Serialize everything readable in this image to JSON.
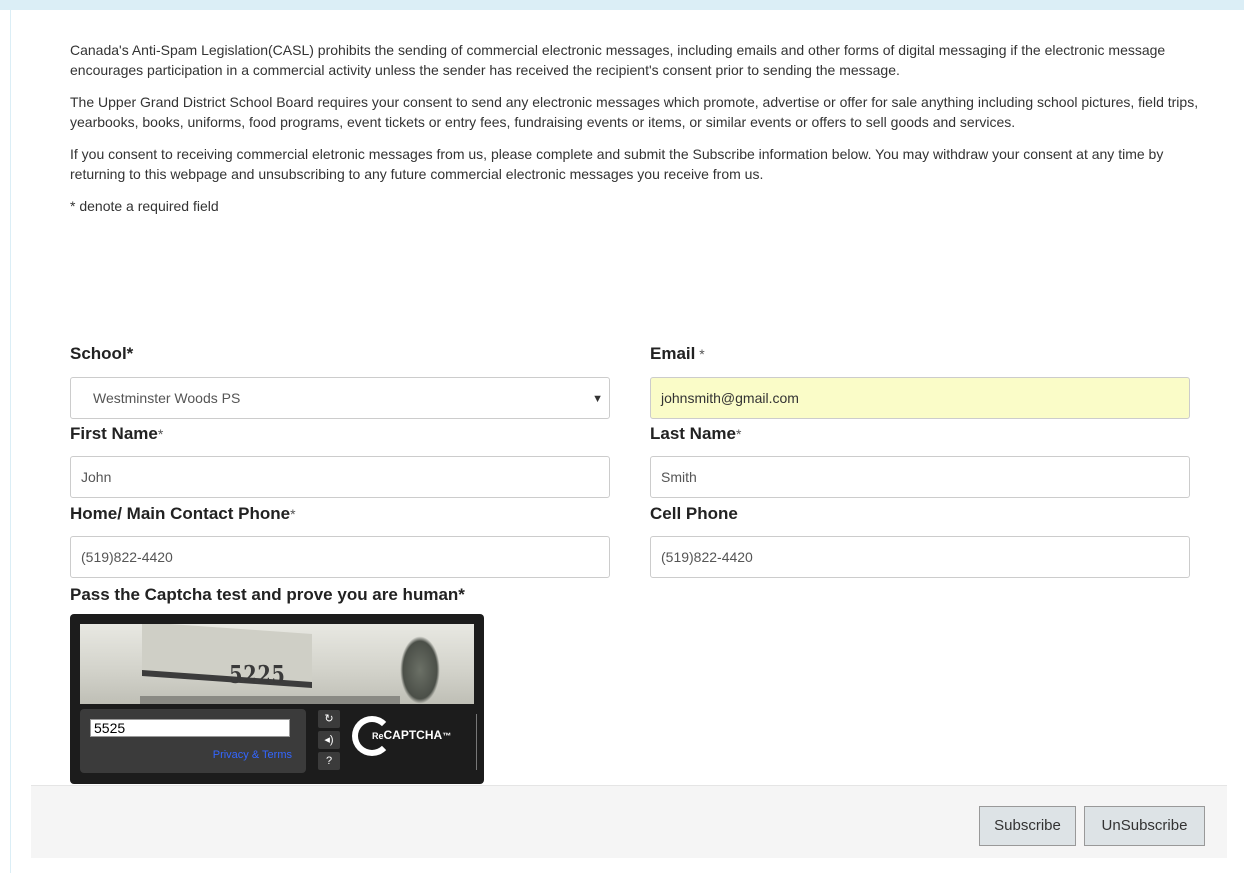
{
  "intro": {
    "paragraph_1": "Canada's Anti-Spam Legislation(CASL) prohibits the sending of commercial electronic messages, including emails and other forms of digital messaging if the electronic message encourages participation in a commercial activity unless the sender has received the recipient's consent prior to sending the message.",
    "paragraph_2": "The Upper Grand District School Board requires your consent to send any electronic messages which promote, advertise or offer for sale anything including school pictures, field trips, yearbooks, books, uniforms, food programs, event tickets or entry fees, fundraising events or items, or similar events or offers to sell goods and services.",
    "paragraph_3": "If you consent to receiving commercial eletronic messages from us, please complete and submit the Subscribe information below. You may withdraw your consent at any time by returning to this webpage and unsubscribing to any future commercial electronic messages you receive from us.",
    "required_note": "* denote a required field"
  },
  "form": {
    "school": {
      "label": "School",
      "star": "*",
      "selected": "Westminster Woods PS",
      "caret": "▼"
    },
    "email": {
      "label": "Email",
      "star": " *",
      "value": "johnsmith@gmail.com"
    },
    "first_name": {
      "label": "First Name",
      "star": "*",
      "value": "John"
    },
    "last_name": {
      "label": "Last Name",
      "star": "*",
      "value": "Smith"
    },
    "home_phone": {
      "label": "Home/ Main Contact Phone",
      "star": "*",
      "value": "(519)822-4420"
    },
    "cell_phone": {
      "label": "Cell Phone",
      "value": "(519)822-4420"
    },
    "captcha_label": "Pass the Captcha test and prove you are human*"
  },
  "captcha": {
    "image_word": "5225",
    "response_value": "5525",
    "privacy_terms": "Privacy & Terms",
    "refresh_glyph": "↻",
    "audio_glyph": "◂)",
    "help_glyph": "?",
    "logo_re": "Re",
    "logo_word": "CAPTCHA",
    "logo_tm": "™",
    "icons": [
      "refresh-icon",
      "audio-icon",
      "help-icon",
      "recaptcha-logo-icon"
    ]
  },
  "footer": {
    "subscribe_label": "Subscribe",
    "unsubscribe_label": "UnSubscribe"
  },
  "colors": {
    "top_bar": "#dbeef6",
    "email_highlight": "#fafcc8",
    "button_bg": "#dde3e6",
    "footer_bg": "#f5f5f5",
    "link_blue": "#3366ff"
  }
}
